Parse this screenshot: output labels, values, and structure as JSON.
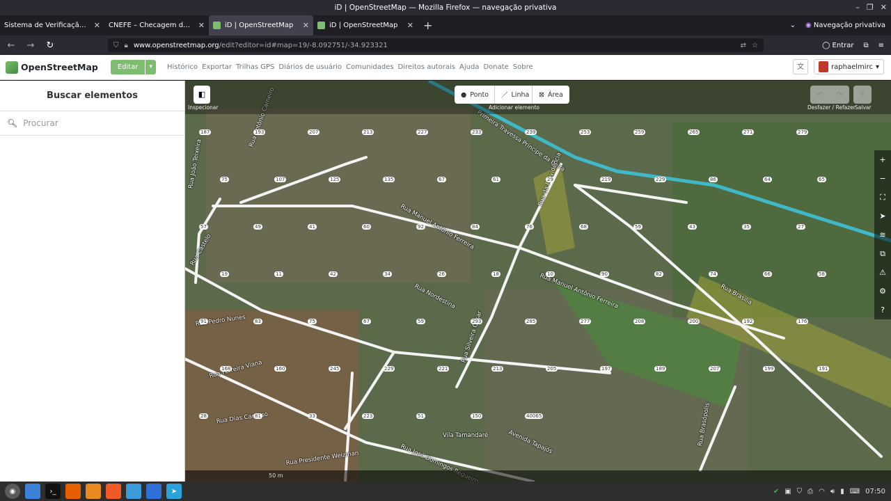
{
  "window": {
    "title": "iD | OpenStreetMap — Mozilla Firefox — navegação privativa"
  },
  "tabs": [
    {
      "label": "Sistema de Verificação CNEFE"
    },
    {
      "label": "CNEFE – Checagem de Logradouros"
    },
    {
      "label": "iD | OpenStreetMap"
    },
    {
      "label": "iD | OpenStreetMap"
    }
  ],
  "tabbar": {
    "private": "Navegação privativa"
  },
  "urlbar": {
    "host": "www.openstreetmap.org",
    "path": "/edit?editor=id#map=19/-8.092751/-34.923321"
  },
  "navbar": {
    "signin": "Entrar"
  },
  "osm": {
    "logo": "OpenStreetMap",
    "edit": "Editar",
    "nav": [
      "Histórico",
      "Exportar",
      "Trilhas GPS",
      "Diários de usuário",
      "Comunidades",
      "Direitos autorais",
      "Ajuda",
      "Donate",
      "Sobre"
    ],
    "user": "raphaelmirc"
  },
  "sidebar": {
    "title": "Buscar elementos",
    "search_placeholder": "Procurar"
  },
  "toolbar": {
    "inspect_label": "Inspecionar",
    "point": "Ponto",
    "line": "Linha",
    "area": "Área",
    "add_label": "Adicionar elemento",
    "undo_label": "Desfazer / Refazer",
    "save_label": "Salvar"
  },
  "map": {
    "streets": [
      "Primeira Travessa Príncipe da Beira",
      "Rua Manuel Antônio Ferreira",
      "Rua da Providência",
      "Rua Manuel Antônio Ferreira",
      "Rua Nordestina",
      "Rua Silveira Cesar",
      "Rua Brasilia",
      "Rua Pedro Nunes",
      "Rua Ferreira Viana",
      "Rua Dias Cardoso",
      "Rua Presidente Weizman",
      "Rua José Domingos Régueiro",
      "Avenida Tapajós",
      "Rua Castelo",
      "Rua João Teixeira",
      "Rua Antônio Carneiro",
      "Vila Tamandaré",
      "Rua Brasópolis"
    ],
    "numbers": [
      "187",
      "193",
      "207",
      "213",
      "227",
      "233",
      "239",
      "253",
      "259",
      "265",
      "271",
      "279",
      "75",
      "107",
      "125",
      "135",
      "67",
      "61",
      "29",
      "219",
      "229",
      "86",
      "64",
      "65",
      "57",
      "49",
      "41",
      "60",
      "92",
      "84",
      "76",
      "68",
      "59",
      "43",
      "35",
      "27",
      "19",
      "11",
      "42",
      "34",
      "26",
      "18",
      "10",
      "90",
      "82",
      "74",
      "66",
      "58",
      "91",
      "83",
      "75",
      "67",
      "59",
      "293",
      "285",
      "277",
      "208",
      "200",
      "192",
      "176",
      "168",
      "160",
      "245",
      "229",
      "221",
      "213",
      "205",
      "197",
      "189",
      "207",
      "199",
      "191",
      "28",
      "81",
      "33",
      "223",
      "51",
      "150",
      "40065"
    ],
    "scale": "50 m"
  },
  "taskbar": {
    "time": "07:50"
  }
}
